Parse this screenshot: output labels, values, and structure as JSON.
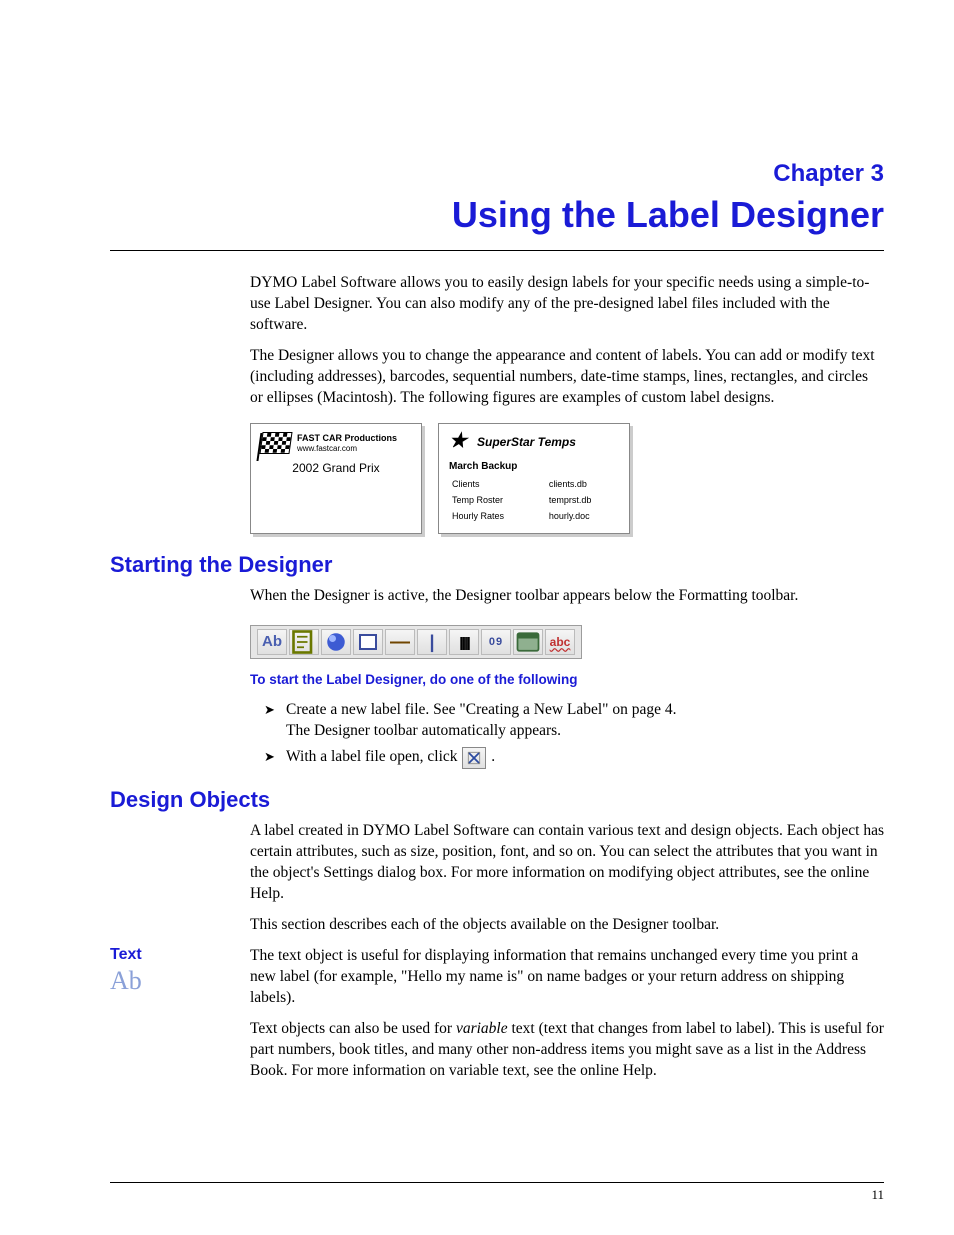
{
  "chapter": {
    "label": "Chapter 3",
    "title": "Using the Label Designer"
  },
  "intro": {
    "p1": "DYMO Label Software allows you to easily design labels for your specific needs using a simple-to-use Label Designer. You can also modify any of the pre-designed label files included with the software.",
    "p2": "The Designer allows you to change the appearance and content of labels. You can add or modify text (including addresses), barcodes, sequential numbers, date-time stamps, lines, rectangles, and circles or ellipses (Macintosh). The following figures are examples of custom label designs."
  },
  "examples": {
    "fastcar": {
      "title": "FAST CAR Productions",
      "url": "www.fastcar.com",
      "subtitle": "2002 Grand Prix"
    },
    "superstar": {
      "title": "SuperStar Temps",
      "section": "March Backup",
      "rows": [
        {
          "name": "Clients",
          "file": "clients.db"
        },
        {
          "name": "Temp Roster",
          "file": "temprst.db"
        },
        {
          "name": "Hourly Rates",
          "file": "hourly.doc"
        }
      ]
    }
  },
  "sections": {
    "starting": {
      "heading": "Starting the Designer",
      "intro": "When the Designer is active, the Designer toolbar appears below the Formatting toolbar.",
      "instruction_heading": "To start the Label Designer, do one of the following",
      "steps": {
        "s1a": "Create a new label file. See \"Creating a New Label\" on page 4.",
        "s1b": "The Designer toolbar automatically appears.",
        "s2_pre": "With a label file open, click ",
        "s2_post": "."
      },
      "toolbar_icons": {
        "text": "Ab",
        "address": "address-icon",
        "graphic": "graphic-icon",
        "rectangle": "rectangle-icon",
        "hline": "—",
        "vline": "|",
        "barcode": "|||||",
        "counter": "09",
        "datetime": "date-icon",
        "curved": "abc"
      }
    },
    "design_objects": {
      "heading": "Design Objects",
      "p1": "A label created in DYMO Label Software can contain various text and design objects. Each object has certain attributes, such as size, position, font, and so on. You can select the attributes that you want in the object's Settings dialog box. For more information on modifying object attributes, see the online Help.",
      "p2": "This section describes each of the objects available on the Designer toolbar."
    },
    "text": {
      "heading": "Text",
      "icon_glyph": "Ab",
      "p1": "The text object is useful for displaying information that remains unchanged every time you print a new label (for example, \"Hello my name is\" on name badges or your return address on shipping labels).",
      "p2_pre": "Text objects can also be used for ",
      "p2_var": "variable",
      "p2_post": " text (text that changes from label to label). This is useful for part numbers, book titles, and many other non-address items you might save as a list in the Address Book. For more information on variable text, see the online Help."
    }
  },
  "page_number": "11"
}
